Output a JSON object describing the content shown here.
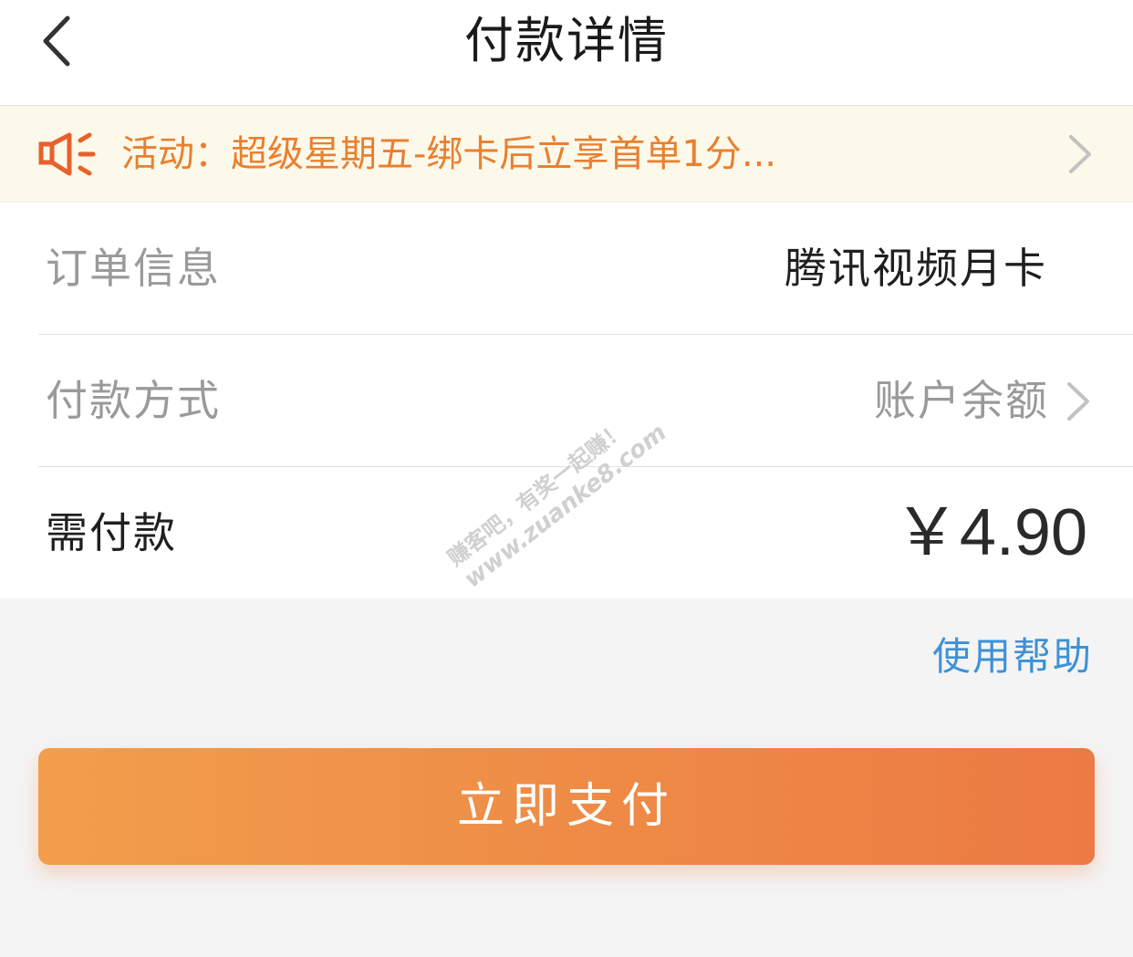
{
  "header": {
    "title": "付款详情",
    "back_icon": "chevron-left-icon"
  },
  "notice": {
    "icon": "speaker-icon",
    "text": "活动：超级星期五-绑卡后立享首单1分...",
    "accent_color": "#e9802f"
  },
  "order": {
    "rows": [
      {
        "label": "订单信息",
        "value": "腾讯视频月卡"
      },
      {
        "label": "付款方式",
        "value": "账户余额"
      },
      {
        "label": "需付款",
        "value": "￥4.90"
      }
    ]
  },
  "watermark": {
    "line1": "赚客吧，有奖一起赚！",
    "line2": "www.zuanke8.com"
  },
  "help": {
    "label": "使用帮助",
    "color": "#3e91d6"
  },
  "pay_button": {
    "label": "立即支付",
    "gradient_start": "#f29e4c",
    "gradient_end": "#ec7a44"
  }
}
